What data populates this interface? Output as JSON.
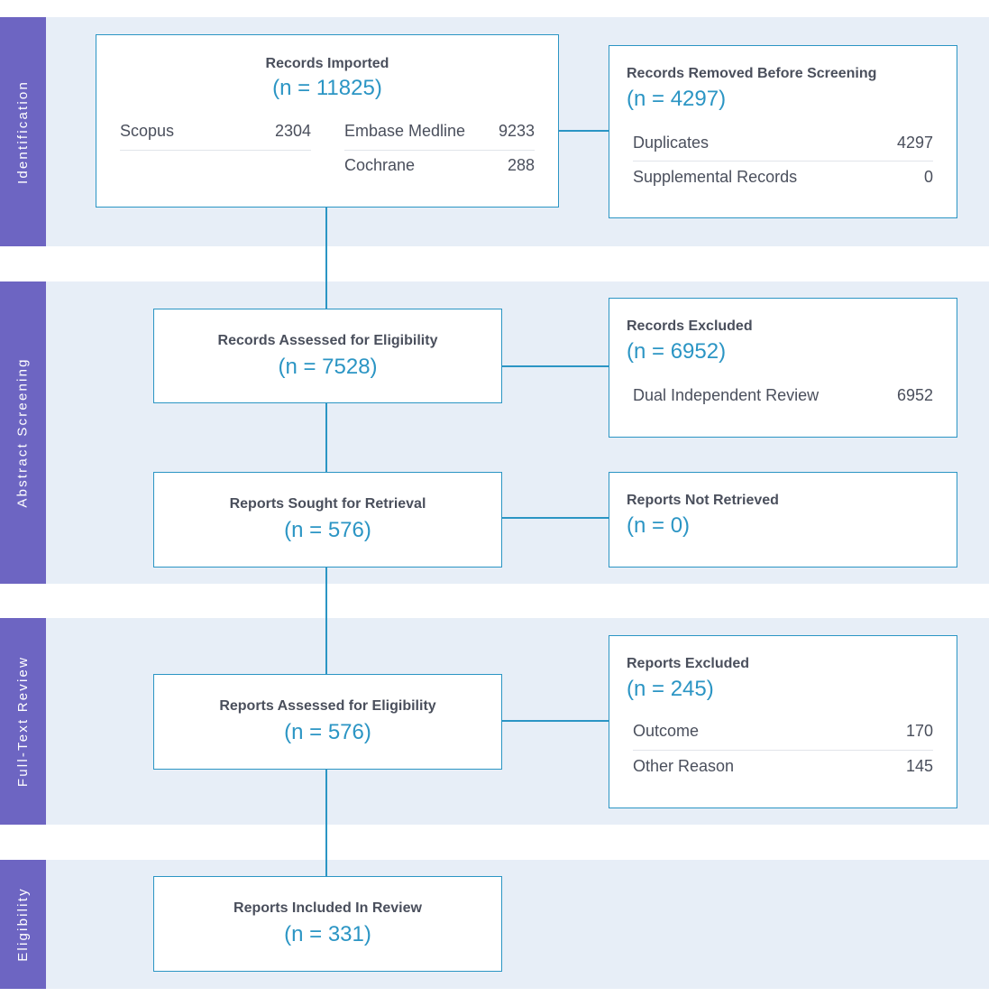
{
  "stages": {
    "identification": "Identification",
    "abstract_screening": "Abstract Screening",
    "full_text_review": "Full-Text Review",
    "eligibility": "Eligibility"
  },
  "records_imported": {
    "title": "Records Imported",
    "count": "(n = 11825)",
    "sources": [
      {
        "label": "Scopus",
        "value": "2304"
      },
      {
        "label": "Embase Medline",
        "value": "9233"
      },
      {
        "label": "Cochrane",
        "value": "288"
      }
    ]
  },
  "records_removed": {
    "title": "Records Removed Before Screening",
    "count": "(n = 4297)",
    "rows": [
      {
        "label": "Duplicates",
        "value": "4297"
      },
      {
        "label": "Supplemental Records",
        "value": "0"
      }
    ]
  },
  "records_assessed": {
    "title": "Records Assessed for Eligibility",
    "count": "(n = 7528)"
  },
  "records_excluded": {
    "title": "Records Excluded",
    "count": "(n = 6952)",
    "rows": [
      {
        "label": "Dual Independent Review",
        "value": "6952"
      }
    ]
  },
  "reports_sought": {
    "title": "Reports Sought for Retrieval",
    "count": "(n = 576)"
  },
  "reports_not_retrieved": {
    "title": "Reports Not Retrieved",
    "count": "(n = 0)"
  },
  "reports_assessed": {
    "title": "Reports Assessed for Eligibility",
    "count": "(n = 576)"
  },
  "reports_excluded": {
    "title": "Reports Excluded",
    "count": "(n = 245)",
    "rows": [
      {
        "label": "Outcome",
        "value": "170"
      },
      {
        "label": "Other Reason",
        "value": "145"
      }
    ]
  },
  "reports_included": {
    "title": "Reports Included In Review",
    "count": "(n = 331)"
  },
  "colors": {
    "band": "#e7eef7",
    "stage_label": "#6d65c2",
    "accent": "#2b95c4",
    "text": "#4a4f5c"
  }
}
